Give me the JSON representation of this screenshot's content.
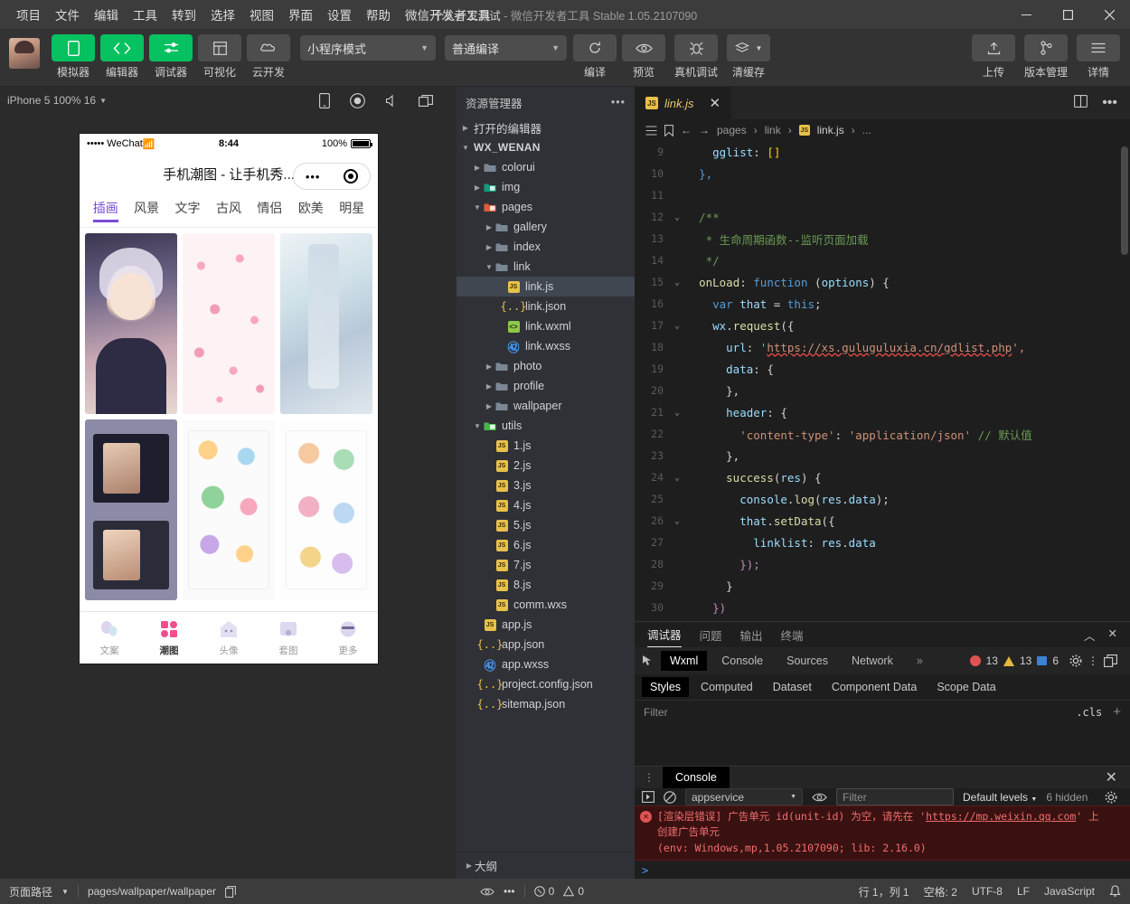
{
  "titlebar": {
    "menus": [
      "项目",
      "文件",
      "编辑",
      "工具",
      "转到",
      "选择",
      "视图",
      "界面",
      "设置",
      "帮助",
      "微信开发者工具"
    ],
    "project_name": "个人开发测试",
    "app_title": "微信开发者工具 Stable 1.05.2107090",
    "separator": "-"
  },
  "toolbar": {
    "buttons": [
      {
        "label": "模拟器",
        "icon": "phone-icon",
        "style": "green"
      },
      {
        "label": "编辑器",
        "icon": "code-icon",
        "style": "green"
      },
      {
        "label": "调试器",
        "icon": "sliders-icon",
        "style": "green"
      },
      {
        "label": "可视化",
        "icon": "layout-icon",
        "style": "grey"
      },
      {
        "label": "云开发",
        "icon": "cloud-icon",
        "style": "grey"
      }
    ],
    "mode_select": "小程序模式",
    "compile_select": "普通编译",
    "actions": [
      {
        "label": "编译",
        "icon": "refresh-icon"
      },
      {
        "label": "预览",
        "icon": "eye-icon"
      },
      {
        "label": "真机调试",
        "icon": "bug-icon"
      },
      {
        "label": "清缓存",
        "icon": "layers-icon"
      }
    ],
    "right_actions": [
      {
        "label": "上传",
        "icon": "upload-icon"
      },
      {
        "label": "版本管理",
        "icon": "branch-icon"
      },
      {
        "label": "详情",
        "icon": "menu-icon"
      }
    ]
  },
  "simulator": {
    "device_label": "iPhone 5 100% 16",
    "icons": [
      "phone-rotate-icon",
      "record-icon",
      "volume-icon",
      "window-icon"
    ],
    "phone": {
      "status_carrier": "•••••  WeChat",
      "status_time": "8:44",
      "status_battery": "100%",
      "nav_title": "手机潮图 - 让手机秀...",
      "capsule_more": "•••",
      "tabs": [
        "插画",
        "风景",
        "文字",
        "古风",
        "情侣",
        "欧美",
        "明星"
      ],
      "active_tab": "插画",
      "bottom_tabs": [
        {
          "label": "文案",
          "icon": "balloon-icon"
        },
        {
          "label": "潮图",
          "icon": "grid-icon"
        },
        {
          "label": "头像",
          "icon": "avatar-icon"
        },
        {
          "label": "套图",
          "icon": "album-icon"
        },
        {
          "label": "更多",
          "icon": "more-icon"
        }
      ],
      "active_bottom_tab": "潮图"
    }
  },
  "explorer": {
    "title": "资源管理器",
    "sections": [
      {
        "label": "打开的编辑器",
        "depth": 0,
        "type": "section",
        "expanded": false
      },
      {
        "label": "WX_WENAN",
        "depth": 0,
        "type": "root",
        "expanded": true
      },
      {
        "label": "colorui",
        "depth": 1,
        "type": "folder",
        "expanded": false
      },
      {
        "label": "img",
        "depth": 1,
        "type": "folder-img",
        "expanded": false
      },
      {
        "label": "pages",
        "depth": 1,
        "type": "folder-pages",
        "expanded": true
      },
      {
        "label": "gallery",
        "depth": 2,
        "type": "folder",
        "expanded": false
      },
      {
        "label": "index",
        "depth": 2,
        "type": "folder",
        "expanded": false
      },
      {
        "label": "link",
        "depth": 2,
        "type": "folder",
        "expanded": true
      },
      {
        "label": "link.js",
        "depth": 3,
        "type": "js",
        "selected": true
      },
      {
        "label": "link.json",
        "depth": 3,
        "type": "json"
      },
      {
        "label": "link.wxml",
        "depth": 3,
        "type": "wxml"
      },
      {
        "label": "link.wxss",
        "depth": 3,
        "type": "wxss"
      },
      {
        "label": "photo",
        "depth": 2,
        "type": "folder",
        "expanded": false
      },
      {
        "label": "profile",
        "depth": 2,
        "type": "folder",
        "expanded": false
      },
      {
        "label": "wallpaper",
        "depth": 2,
        "type": "folder",
        "expanded": false
      },
      {
        "label": "utils",
        "depth": 1,
        "type": "folder-utils",
        "expanded": true
      },
      {
        "label": "1.js",
        "depth": 2,
        "type": "js"
      },
      {
        "label": "2.js",
        "depth": 2,
        "type": "js"
      },
      {
        "label": "3.js",
        "depth": 2,
        "type": "js"
      },
      {
        "label": "4.js",
        "depth": 2,
        "type": "js"
      },
      {
        "label": "5.js",
        "depth": 2,
        "type": "js"
      },
      {
        "label": "6.js",
        "depth": 2,
        "type": "js"
      },
      {
        "label": "7.js",
        "depth": 2,
        "type": "js"
      },
      {
        "label": "8.js",
        "depth": 2,
        "type": "js"
      },
      {
        "label": "comm.wxs",
        "depth": 2,
        "type": "js"
      },
      {
        "label": "app.js",
        "depth": 1,
        "type": "js"
      },
      {
        "label": "app.json",
        "depth": 1,
        "type": "json"
      },
      {
        "label": "app.wxss",
        "depth": 1,
        "type": "wxss"
      },
      {
        "label": "project.config.json",
        "depth": 1,
        "type": "json"
      },
      {
        "label": "sitemap.json",
        "depth": 1,
        "type": "json"
      }
    ],
    "outline": "大纲"
  },
  "editor": {
    "tab": {
      "name": "link.js",
      "icon": "js-icon"
    },
    "breadcrumb": [
      "pages",
      "link",
      "link.js",
      "..."
    ],
    "lines": [
      {
        "n": "9",
        "fold": "",
        "segs": [
          {
            "t": "    ",
            "c": ""
          },
          {
            "t": "gglist",
            "c": "k-prop"
          },
          {
            "t": ": ",
            "c": ""
          },
          {
            "t": "[]",
            "c": "k-brk"
          }
        ]
      },
      {
        "n": "10",
        "fold": "",
        "segs": [
          {
            "t": "  ",
            "c": ""
          },
          {
            "t": "},",
            "c": "k-blue"
          }
        ]
      },
      {
        "n": "11",
        "fold": "",
        "segs": []
      },
      {
        "n": "12",
        "fold": "v",
        "segs": [
          {
            "t": "  /**",
            "c": "k-com"
          }
        ]
      },
      {
        "n": "13",
        "fold": "",
        "segs": [
          {
            "t": "   * 生命周期函数--监听页面加载",
            "c": "k-com"
          }
        ]
      },
      {
        "n": "14",
        "fold": "",
        "segs": [
          {
            "t": "   */",
            "c": "k-com"
          }
        ]
      },
      {
        "n": "15",
        "fold": "v",
        "segs": [
          {
            "t": "  ",
            "c": ""
          },
          {
            "t": "onLoad",
            "c": "k-yel"
          },
          {
            "t": ": ",
            "c": ""
          },
          {
            "t": "function",
            "c": "k-blue"
          },
          {
            "t": " (",
            "c": ""
          },
          {
            "t": "options",
            "c": "k-var"
          },
          {
            "t": ") {",
            "c": ""
          }
        ]
      },
      {
        "n": "16",
        "fold": "",
        "segs": [
          {
            "t": "    ",
            "c": ""
          },
          {
            "t": "var",
            "c": "k-blue"
          },
          {
            "t": " ",
            "c": ""
          },
          {
            "t": "that",
            "c": "k-var"
          },
          {
            "t": " = ",
            "c": ""
          },
          {
            "t": "this",
            "c": "k-blue"
          },
          {
            "t": ";",
            "c": ""
          }
        ]
      },
      {
        "n": "17",
        "fold": "v",
        "segs": [
          {
            "t": "    ",
            "c": ""
          },
          {
            "t": "wx",
            "c": "k-var"
          },
          {
            "t": ".",
            "c": ""
          },
          {
            "t": "request",
            "c": "k-yel"
          },
          {
            "t": "({",
            "c": ""
          }
        ]
      },
      {
        "n": "18",
        "fold": "",
        "segs": [
          {
            "t": "      ",
            "c": ""
          },
          {
            "t": "url",
            "c": "k-prop"
          },
          {
            "t": ": ",
            "c": ""
          },
          {
            "t": "'",
            "c": "k-str"
          },
          {
            "t": "https://xs.guluguluxia.cn/gdlist.php",
            "c": "k-url"
          },
          {
            "t": "',",
            "c": "k-str"
          }
        ]
      },
      {
        "n": "19",
        "fold": "",
        "segs": [
          {
            "t": "      ",
            "c": ""
          },
          {
            "t": "data",
            "c": "k-prop"
          },
          {
            "t": ": {",
            "c": ""
          }
        ]
      },
      {
        "n": "20",
        "fold": "",
        "segs": [
          {
            "t": "      },",
            "c": ""
          }
        ]
      },
      {
        "n": "21",
        "fold": "v",
        "segs": [
          {
            "t": "      ",
            "c": ""
          },
          {
            "t": "header",
            "c": "k-prop"
          },
          {
            "t": ": {",
            "c": ""
          }
        ]
      },
      {
        "n": "22",
        "fold": "",
        "segs": [
          {
            "t": "        ",
            "c": ""
          },
          {
            "t": "'content-type'",
            "c": "k-str"
          },
          {
            "t": ": ",
            "c": ""
          },
          {
            "t": "'application/json'",
            "c": "k-str"
          },
          {
            "t": " ",
            "c": ""
          },
          {
            "t": "// 默认值",
            "c": "k-com"
          }
        ]
      },
      {
        "n": "23",
        "fold": "",
        "segs": [
          {
            "t": "      },",
            "c": ""
          }
        ]
      },
      {
        "n": "24",
        "fold": "v",
        "segs": [
          {
            "t": "      ",
            "c": ""
          },
          {
            "t": "success",
            "c": "k-yel"
          },
          {
            "t": "(",
            "c": ""
          },
          {
            "t": "res",
            "c": "k-var"
          },
          {
            "t": ") {",
            "c": ""
          }
        ]
      },
      {
        "n": "25",
        "fold": "",
        "segs": [
          {
            "t": "        ",
            "c": ""
          },
          {
            "t": "console",
            "c": "k-var"
          },
          {
            "t": ".",
            "c": ""
          },
          {
            "t": "log",
            "c": "k-yel"
          },
          {
            "t": "(",
            "c": ""
          },
          {
            "t": "res",
            "c": "k-var"
          },
          {
            "t": ".",
            "c": ""
          },
          {
            "t": "data",
            "c": "k-var"
          },
          {
            "t": ");",
            "c": ""
          }
        ]
      },
      {
        "n": "26",
        "fold": "v",
        "segs": [
          {
            "t": "        ",
            "c": ""
          },
          {
            "t": "that",
            "c": "k-var"
          },
          {
            "t": ".",
            "c": ""
          },
          {
            "t": "setData",
            "c": "k-yel"
          },
          {
            "t": "({",
            "c": ""
          }
        ]
      },
      {
        "n": "27",
        "fold": "",
        "segs": [
          {
            "t": "          ",
            "c": ""
          },
          {
            "t": "linklist",
            "c": "k-prop"
          },
          {
            "t": ": ",
            "c": ""
          },
          {
            "t": "res",
            "c": "k-var"
          },
          {
            "t": ".",
            "c": ""
          },
          {
            "t": "data",
            "c": "k-var"
          }
        ]
      },
      {
        "n": "28",
        "fold": "",
        "segs": [
          {
            "t": "        ",
            "c": ""
          },
          {
            "t": "});",
            "c": "k-pur"
          }
        ]
      },
      {
        "n": "29",
        "fold": "",
        "segs": [
          {
            "t": "      }",
            "c": ""
          }
        ]
      },
      {
        "n": "30",
        "fold": "",
        "segs": [
          {
            "t": "    ",
            "c": ""
          },
          {
            "t": "})",
            "c": "k-pur"
          }
        ]
      }
    ]
  },
  "debugger": {
    "panel_tabs": [
      "调试器",
      "问题",
      "输出",
      "终端"
    ],
    "panel_active": "调试器",
    "devtool_tabs": [
      "Wxml",
      "Console",
      "Sources",
      "Network"
    ],
    "devtool_active": "Wxml",
    "overflow": "»",
    "counts": {
      "errors": "13",
      "warnings": "13",
      "infos": "6"
    },
    "style_tabs": [
      "Styles",
      "Computed",
      "Dataset",
      "Component Data",
      "Scope Data"
    ],
    "style_active": "Styles",
    "filter_placeholder": "Filter",
    "cls_label": ".cls"
  },
  "console": {
    "tab": "Console",
    "source": "appservice",
    "filter_placeholder": "Filter",
    "levels": "Default levels",
    "hidden": "6 hidden",
    "error_line1_a": "[渲染层错误] 广告单元 id(unit-id) 为空，请先在 '",
    "error_link": "https://mp.weixin.qq.com",
    "error_line1_b": "' 上",
    "error_line2": "创建广告单元",
    "error_line3": "(env: Windows,mp,1.05.2107090; lib: 2.16.0)",
    "prompt": ">"
  },
  "statusbar": {
    "page_path_label": "页面路径",
    "page_path": "pages/wallpaper/wallpaper",
    "errors": "0",
    "warnings": "0",
    "position": "行 1，列 1",
    "spaces": "空格: 2",
    "encoding": "UTF-8",
    "eol": "LF",
    "language": "JavaScript"
  }
}
